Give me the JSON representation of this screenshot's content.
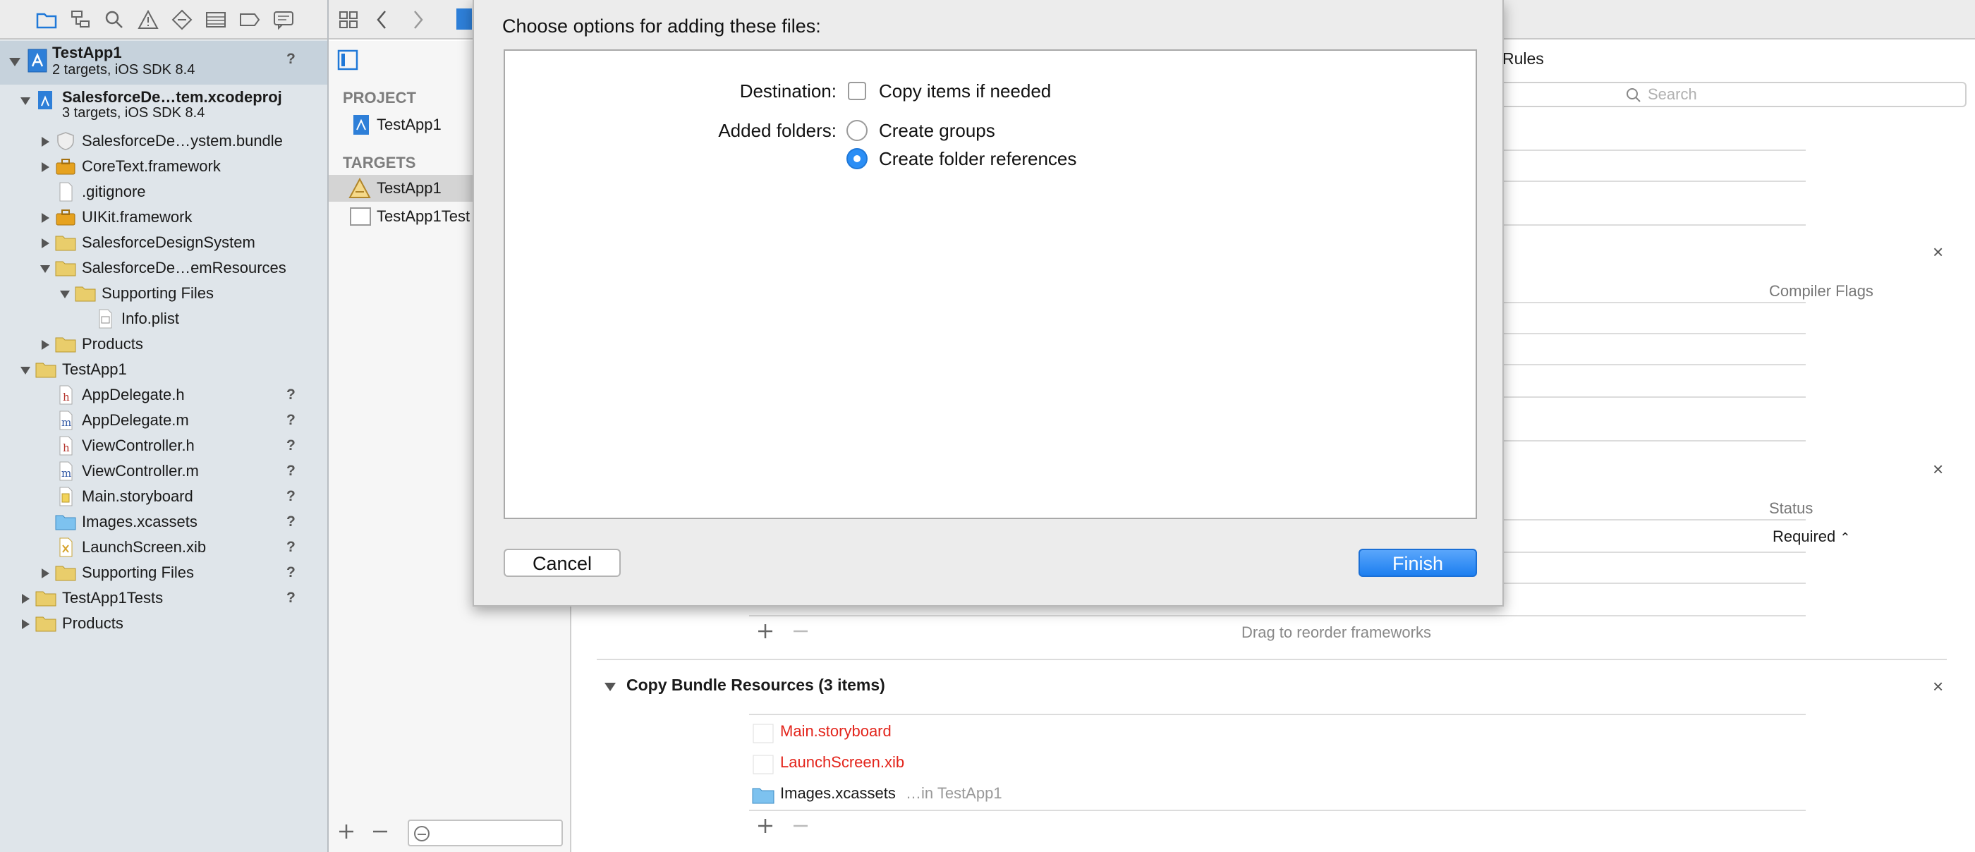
{
  "navigator": {
    "toolbar_icons": [
      "folder-icon",
      "hierarchy-icon",
      "search-icon",
      "warning-icon",
      "test-diamond-icon",
      "list-icon",
      "breakpoint-icon",
      "comment-icon"
    ],
    "project": {
      "name": "TestApp1",
      "subtitle": "2 targets, iOS SDK 8.4",
      "status": "?"
    },
    "tree": [
      {
        "label": "SalesforceDe…tem.xcodeproj",
        "sub": "3 targets, iOS SDK 8.4",
        "icon": "xcodeproj-icon",
        "bold": true
      },
      {
        "label": "SalesforceDe…ystem.bundle",
        "icon": "bundle-icon"
      },
      {
        "label": "CoreText.framework",
        "icon": "framework-icon"
      },
      {
        "label": ".gitignore",
        "icon": "file-icon"
      },
      {
        "label": "UIKit.framework",
        "icon": "framework-icon"
      },
      {
        "label": "SalesforceDesignSystem",
        "icon": "folder-icon"
      },
      {
        "label": "SalesforceDe…emResources",
        "icon": "folder-icon"
      },
      {
        "label": "Supporting Files",
        "icon": "folder-icon"
      },
      {
        "label": "Info.plist",
        "icon": "plist-icon"
      },
      {
        "label": "Products",
        "icon": "folder-icon"
      },
      {
        "label": "TestApp1",
        "icon": "folder-icon"
      },
      {
        "label": "AppDelegate.h",
        "icon": "header-file-icon",
        "status": "?"
      },
      {
        "label": "AppDelegate.m",
        "icon": "impl-file-icon",
        "status": "?"
      },
      {
        "label": "ViewController.h",
        "icon": "header-file-icon",
        "status": "?"
      },
      {
        "label": "ViewController.m",
        "icon": "impl-file-icon",
        "status": "?"
      },
      {
        "label": "Main.storyboard",
        "icon": "storyboard-icon",
        "status": "?"
      },
      {
        "label": "Images.xcassets",
        "icon": "xcassets-folder-icon",
        "status": "?"
      },
      {
        "label": "LaunchScreen.xib",
        "icon": "xib-icon",
        "status": "?"
      },
      {
        "label": "Supporting Files",
        "icon": "folder-icon",
        "status": "?"
      },
      {
        "label": "TestApp1Tests",
        "icon": "folder-icon",
        "status": "?"
      },
      {
        "label": "Products",
        "icon": "folder-icon"
      }
    ]
  },
  "project_column": {
    "project_header": "PROJECT",
    "project_item": "TestApp1",
    "targets_header": "TARGETS",
    "targets": [
      "TestApp1",
      "TestApp1Test"
    ]
  },
  "editor": {
    "tab_partial": "Rules",
    "search_placeholder": "Search",
    "compiler_flags_header": "Compiler Flags",
    "status_header": "Status",
    "status_value": "Required",
    "drag_hint": "Drag to reorder frameworks",
    "copy_bundle": {
      "title": "Copy Bundle Resources (3 items)",
      "items": [
        {
          "name": "Main.storyboard",
          "color": "#e3241b",
          "suffix": ""
        },
        {
          "name": "LaunchScreen.xib",
          "color": "#e3241b",
          "suffix": ""
        },
        {
          "name": "Images.xcassets",
          "color": "#1a1a1a",
          "suffix": "…in TestApp1"
        }
      ]
    }
  },
  "sheet": {
    "title": "Choose options for adding these files:",
    "destination_label": "Destination:",
    "copy_items_label": "Copy items if needed",
    "copy_items_checked": false,
    "added_folders_label": "Added folders:",
    "create_groups_label": "Create groups",
    "create_folder_refs_label": "Create folder references",
    "selected_option": "Create folder references",
    "cancel_label": "Cancel",
    "finish_label": "Finish"
  },
  "colors": {
    "accent": "#1d7ff0",
    "missing_file": "#e3241b",
    "navigator_bg": "#dfe5ea"
  }
}
